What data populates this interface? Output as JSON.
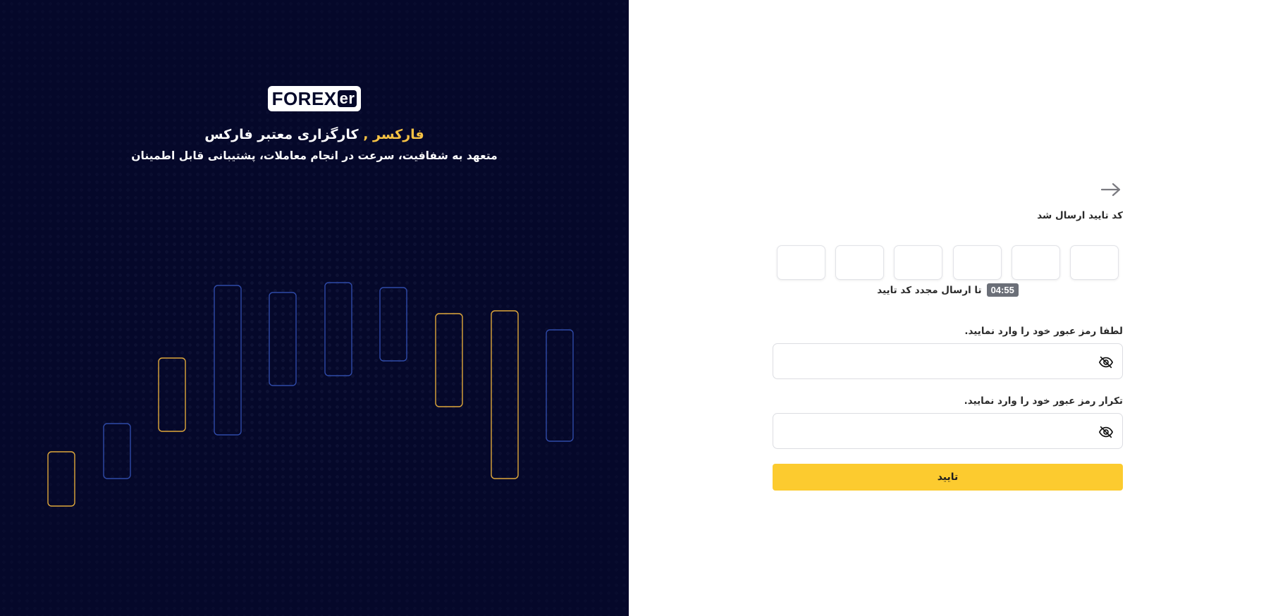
{
  "brand": {
    "logo_main": "FOREX",
    "logo_suffix": "er",
    "headline_accent": "فارکسر ,",
    "headline_rest": "کارگزاری معتبر فارکس",
    "subline": "متعهد به شفافیت، سرعت در انجام معاملات، پشتیبانی قابل اطمینان",
    "accent_color": "#f6c244",
    "background_color": "#05082a"
  },
  "form": {
    "back_icon": "arrow-right-icon",
    "title": "کد تایید ارسال شد",
    "otp_digits": [
      "",
      "",
      "",
      "",
      "",
      "",
      "",
      ""
    ],
    "timer": "04:55",
    "resend_text": "تا ارسال مجدد کد تایید",
    "password": {
      "label": "لطفا رمز عبور خود را وارد نمایید.",
      "value": "",
      "icon": "eye-off-icon"
    },
    "password_confirm": {
      "label": "تکرار رمز عبور خود را وارد نمایید.",
      "value": "",
      "icon": "eye-off-icon"
    },
    "submit_label": "تایید",
    "submit_color": "#fccb2f"
  }
}
